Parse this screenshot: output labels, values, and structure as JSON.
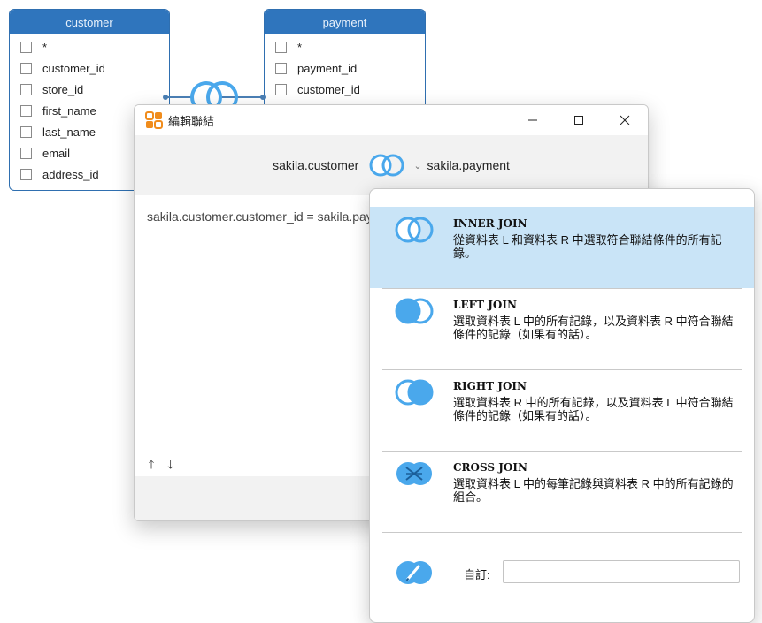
{
  "canvas": {
    "tables": [
      {
        "title": "customer",
        "fields": [
          "*",
          "customer_id",
          "store_id",
          "first_name",
          "last_name",
          "email",
          "address_id"
        ]
      },
      {
        "title": "payment",
        "fields": [
          "*",
          "payment_id",
          "customer_id"
        ]
      }
    ]
  },
  "dialog": {
    "title": "編輯聯結",
    "left_table": "sakila.customer",
    "right_table": "sakila.payment",
    "condition": "sakila.customer.customer_id = sakila.payment.customer_id",
    "move_up": "🡑",
    "move_down": "🡓"
  },
  "join_menu": {
    "options": [
      {
        "name": "INNER JOIN",
        "desc": "從資料表 L 和資料表 R 中選取符合聯結條件的所有記錄。",
        "icon": "inner-join-icon",
        "selected": true
      },
      {
        "name": "LEFT JOIN",
        "desc": "選取資料表 L 中的所有記錄，以及資料表 R 中符合聯結條件的記錄（如果有的話）。",
        "icon": "left-join-icon",
        "selected": false
      },
      {
        "name": "RIGHT JOIN",
        "desc": "選取資料表 R 中的所有記錄，以及資料表 L 中符合聯結條件的記錄（如果有的話）。",
        "icon": "right-join-icon",
        "selected": false
      },
      {
        "name": "CROSS JOIN",
        "desc": "選取資料表 L 中的每筆記錄與資料表 R 中的所有記錄的組合。",
        "icon": "cross-join-icon",
        "selected": false
      }
    ],
    "custom_label": "自訂:",
    "custom_value": ""
  },
  "colors": {
    "accent": "#2f75bd",
    "join_blue": "#4aa8ec",
    "selected_bg": "#c9e4f7"
  }
}
